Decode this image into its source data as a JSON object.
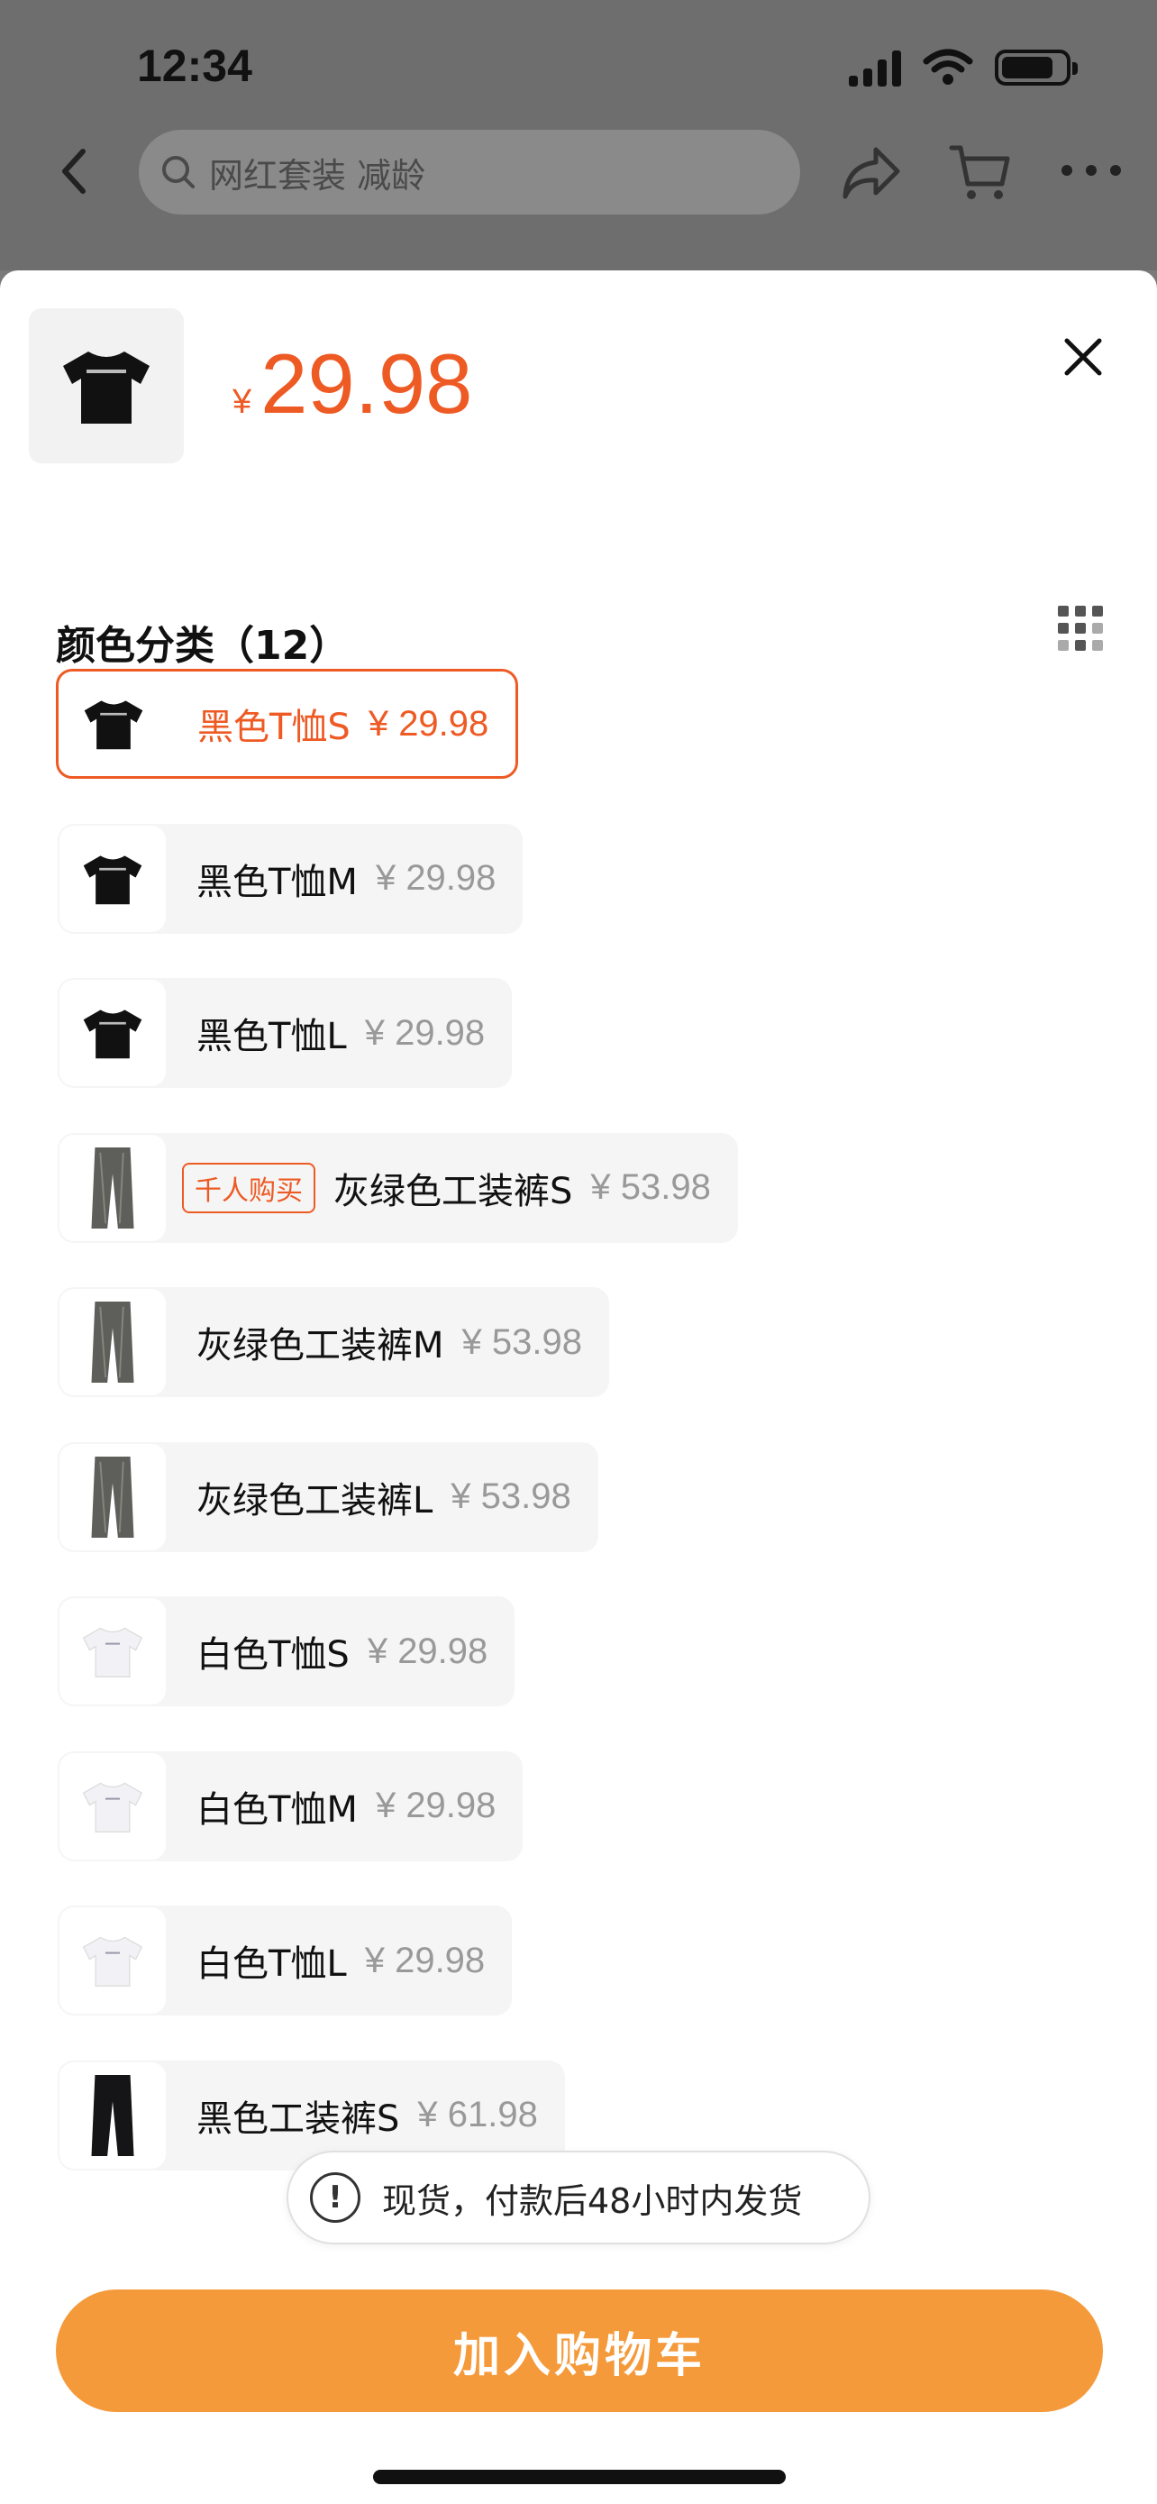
{
  "status_bar": {
    "time": "12:34"
  },
  "top_nav": {
    "search_placeholder": "网红套装 减龄",
    "icons": [
      "back-arrow-icon",
      "search-icon",
      "share-icon",
      "cart-icon",
      "more-icon"
    ]
  },
  "product": {
    "currency": "¥",
    "price": "29.98",
    "thumbnail": "black-tshirt"
  },
  "section": {
    "title": "颜色分类（12）"
  },
  "variants": [
    {
      "name": "黑色T恤S",
      "price": "¥ 29.98",
      "image": "black-tshirt",
      "selected": true
    },
    {
      "name": "黑色T恤M",
      "price": "¥ 29.98",
      "image": "black-tshirt"
    },
    {
      "name": "黑色T恤L",
      "price": "¥ 29.98",
      "image": "black-tshirt"
    },
    {
      "name": "灰绿色工装裤S",
      "price": "¥ 53.98",
      "image": "gray-pants",
      "badge": "千人购买"
    },
    {
      "name": "灰绿色工装裤M",
      "price": "¥ 53.98",
      "image": "gray-pants"
    },
    {
      "name": "灰绿色工装裤L",
      "price": "¥ 53.98",
      "image": "gray-pants"
    },
    {
      "name": "白色T恤S",
      "price": "¥ 29.98",
      "image": "white-tshirt"
    },
    {
      "name": "白色T恤M",
      "price": "¥ 29.98",
      "image": "white-tshirt"
    },
    {
      "name": "白色T恤L",
      "price": "¥ 29.98",
      "image": "white-tshirt"
    },
    {
      "name": "黑色工装裤S",
      "price": "¥ 61.98",
      "image": "black-pants"
    }
  ],
  "toast": {
    "text": "现货，付款后48小时内发货"
  },
  "add_to_cart": {
    "label": "加入购物车"
  },
  "colors": {
    "accent": "#ee5a24",
    "button": "#f59a3a"
  }
}
